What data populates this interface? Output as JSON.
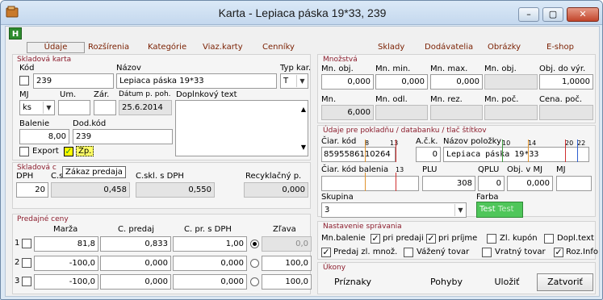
{
  "window": {
    "title": "Karta - Lepiaca páska 19*33, 239",
    "minimize": "–",
    "maximize": "▢",
    "close": "✕"
  },
  "toolbar": {
    "h_button": "H"
  },
  "tabs": [
    "Údaje",
    "Rozšírenia",
    "Kategórie",
    "Viaz.karty",
    "Cenníky",
    "Sklady",
    "Dodávatelia",
    "Obrázky",
    "E-shop"
  ],
  "skladova_karta": {
    "title": "Skladová karta",
    "kod_label": "Kód",
    "kod_value": "239",
    "nazov_label": "Názov",
    "nazov_value": "Lepiaca páska 19*33",
    "typ_label": "Typ kar.",
    "typ_value": "T",
    "mj_label": "MJ",
    "mj_value": "ks",
    "um_label": "Um.",
    "zar_label": "Zár.",
    "datum_label": "Dátum p. poh.",
    "datum_value": "25.6.2014",
    "dopl_label": "Doplnkový text",
    "balenie_label": "Balenie",
    "balenie_value": "8,00",
    "dodkod_label": "Dod.kód",
    "dodkod_value": "239",
    "export_label": "Export",
    "zp_label": "Zp.",
    "tooltip": "Zákaz predaja"
  },
  "skladova_cena": {
    "title": "Skladová c",
    "dph_label": "DPH",
    "dph_value": "20",
    "cskl_label": "C.s",
    "cskl_value": "0,458",
    "cskl_dph_label": "C.skl. s DPH",
    "cskl_dph_value": "0,550",
    "recykl_label": "Recyklačný p.",
    "recykl_value": "0,000"
  },
  "predajne_ceny": {
    "title": "Predajné ceny",
    "headers": [
      "Marža",
      "C. predaj",
      "C. pr. s DPH",
      "Zľava"
    ],
    "rows": [
      {
        "num": "1",
        "marza": "81,8",
        "predaj": "0,833",
        "s_dph": "1,00",
        "zlava": "0,0"
      },
      {
        "num": "2",
        "marza": "-100,0",
        "predaj": "0,000",
        "s_dph": "0,000",
        "zlava": "100,0"
      },
      {
        "num": "3",
        "marza": "-100,0",
        "predaj": "0,000",
        "s_dph": "0,000",
        "zlava": "100,0"
      }
    ]
  },
  "mnozstva": {
    "title": "Množstvá",
    "row1_labels": [
      "Mn. obj.",
      "Mn. min.",
      "Mn. max.",
      "Mn. obj.",
      "Obj. do výr."
    ],
    "row1_values": [
      "0,000",
      "0,000",
      "0,000",
      "",
      "1,0000"
    ],
    "row2_labels": [
      "Mn.",
      "Mn. odl.",
      "Mn. rez.",
      "Mn. poč.",
      "Cena. poč."
    ],
    "row2_values": [
      "6,000",
      "",
      "",
      "",
      ""
    ]
  },
  "udaje_pokladnu": {
    "title": "Údaje pre pokladňu / databanku / tlač štítkov",
    "ciar_label": "Čiar. kód",
    "ciar_value": "8595586110264",
    "ack_label": "A.č.k.",
    "ack_value": "0",
    "nazov_pol_label": "Názov položky",
    "nazov_pol_value": "Lepiaca páska 19*33",
    "ticks": [
      "8",
      "13",
      "10",
      "14",
      "20",
      "22"
    ],
    "ciar_bal_label": "Čiar. kód balenia",
    "ticks2": [
      "13"
    ],
    "plu_label": "PLU",
    "plu_value": "308",
    "qplu_label": "QPLU",
    "qplu_value": "0",
    "objmj_label": "Obj. v MJ",
    "objmj_value": "0,000",
    "mj_label": "MJ",
    "skupina_label": "Skupina",
    "skupina_value": "3",
    "farba_label": "Farba",
    "farba_text1": "Test",
    "farba_text2": "Test",
    "farba_color": "#4fc65a"
  },
  "nastavenie": {
    "title": "Nastavenie správania",
    "mn_balenie_label": "Mn.balenie",
    "items": [
      {
        "label": "pri predaji",
        "checked": true
      },
      {
        "label": "pri príjme",
        "checked": true
      },
      {
        "label": "Zl. kupón",
        "checked": false
      },
      {
        "label": "Dopl.text",
        "checked": false
      },
      {
        "label": "Predaj zl. množ.",
        "checked": true
      },
      {
        "label": "Vážený tovar",
        "checked": false
      },
      {
        "label": "Vratný tovar",
        "checked": false
      },
      {
        "label": "Roz.Info",
        "checked": true
      }
    ]
  },
  "ukony": {
    "title": "Úkony",
    "buttons": [
      "Príznaky",
      "Pohyby",
      "Uložiť",
      "Zatvoriť"
    ]
  }
}
